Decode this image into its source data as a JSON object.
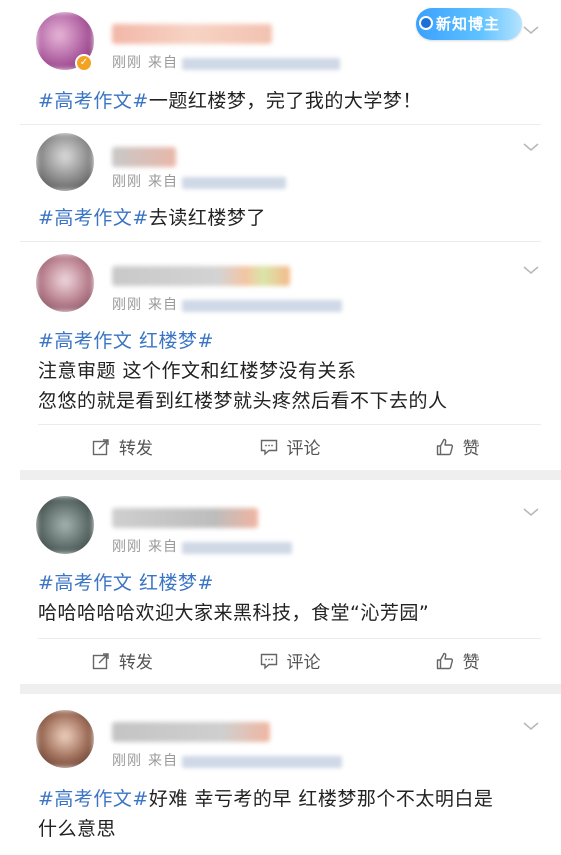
{
  "badge": {
    "label": "新知博主"
  },
  "meta": {
    "time": "刚刚",
    "source_prefix": "来自"
  },
  "actions": {
    "repost": "转发",
    "comment": "评论",
    "like": "赞"
  },
  "posts": [
    {
      "hashtag": "#高考作文#",
      "text": "一题红楼梦，完了我的大学梦！"
    },
    {
      "hashtag": "#高考作文#",
      "text": "去读红楼梦了"
    },
    {
      "hashtag": "#高考作文 红楼梦#",
      "line2": "注意审题 这个作文和红楼梦没有关系",
      "line3": "忽悠的就是看到红楼梦就头疼然后看不下去的人"
    },
    {
      "hashtag": "#高考作文 红楼梦#",
      "line2": "哈哈哈哈哈欢迎大家来黑科技，食堂“沁芳园”"
    },
    {
      "hashtag": "#高考作文#",
      "text": "好难 幸亏考的早 红楼梦那个不太明白是",
      "line2": "什么意思"
    }
  ],
  "colors": {
    "hashtag": "#3a74c5",
    "meta": "#9a9a9a",
    "verified": "#f3a322"
  },
  "icons": [
    "chevron-down-icon",
    "repost-icon",
    "comment-icon",
    "like-icon",
    "verified-icon"
  ]
}
